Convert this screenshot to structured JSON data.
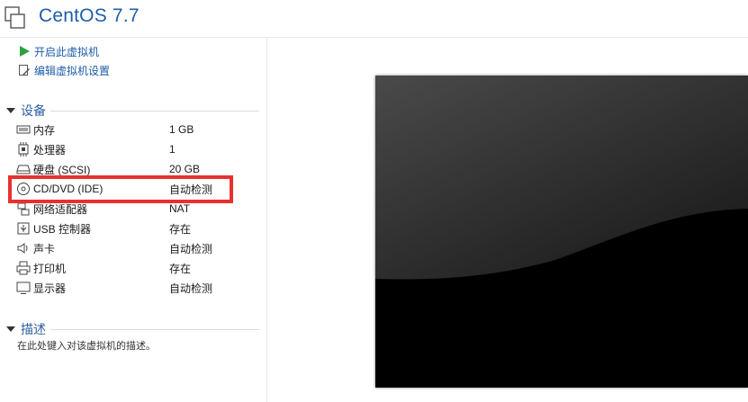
{
  "window": {
    "title": "CentOS 7.7"
  },
  "actions": {
    "power_on": {
      "label": "开启此虚拟机",
      "icon": "play-icon"
    },
    "edit_settings": {
      "label": "编辑虚拟机设置",
      "icon": "edit-settings-icon"
    }
  },
  "devices": {
    "header": "设备",
    "items": [
      {
        "name": "内存",
        "value": "1 GB",
        "icon": "memory-icon"
      },
      {
        "name": "处理器",
        "value": "1",
        "icon": "processor-icon"
      },
      {
        "name": "硬盘 (SCSI)",
        "value": "20 GB",
        "icon": "hard-disk-icon"
      },
      {
        "name": "CD/DVD (IDE)",
        "value": "自动检测",
        "icon": "cd-dvd-icon"
      },
      {
        "name": "网络适配器",
        "value": "NAT",
        "icon": "network-adapter-icon"
      },
      {
        "name": "USB 控制器",
        "value": "存在",
        "icon": "usb-icon"
      },
      {
        "name": "声卡",
        "value": "自动检测",
        "icon": "speaker-icon"
      },
      {
        "name": "打印机",
        "value": "存在",
        "icon": "printer-icon"
      },
      {
        "name": "显示器",
        "value": "自动检测",
        "icon": "monitor-icon"
      }
    ]
  },
  "description": {
    "header": "描述",
    "placeholder": "在此处键入对该虚拟机的描述。"
  },
  "colors": {
    "accent": "#1f5da8",
    "highlight": "#e8312f"
  }
}
